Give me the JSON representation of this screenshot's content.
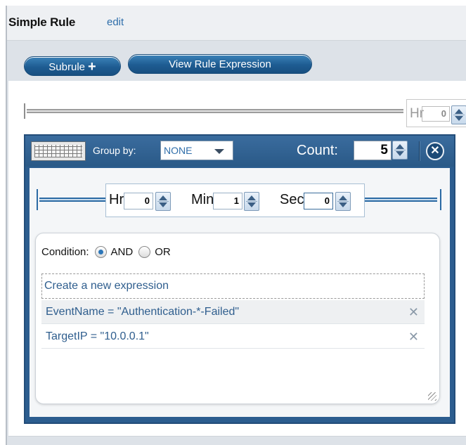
{
  "header": {
    "title": "Simple Rule",
    "edit_label": "edit"
  },
  "toolbar": {
    "subrule_label": "Subrule",
    "view_expression_label": "View Rule Expression"
  },
  "top_timeline": {
    "hr_label": "Hr",
    "hr_value": "0"
  },
  "group": {
    "group_by_label": "Group by:",
    "group_by_value": "NONE",
    "count_label": "Count:",
    "count_value": "5"
  },
  "time_window": {
    "hr_label": "Hr",
    "hr_value": "0",
    "min_label": "Min",
    "min_value": "1",
    "sec_label": "Sec",
    "sec_value": "0"
  },
  "condition": {
    "label": "Condition:",
    "options": [
      {
        "label": "AND",
        "selected": true
      },
      {
        "label": "OR",
        "selected": false
      }
    ],
    "new_expression_placeholder": "Create a new expression",
    "expressions": [
      {
        "text": "EventName = \"Authentication-*-Failed\""
      },
      {
        "text": "TargetIP = \"10.0.0.1\""
      }
    ]
  }
}
